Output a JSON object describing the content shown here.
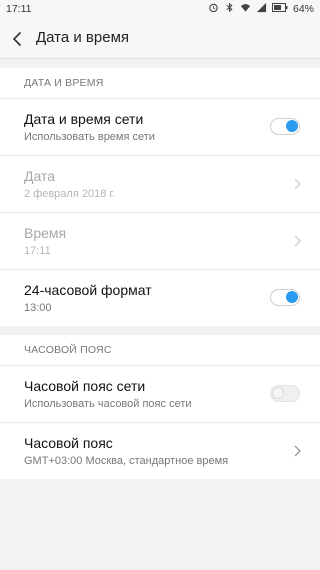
{
  "status": {
    "time": "17:11",
    "battery": "64%",
    "icons": [
      "alarm-icon",
      "bluetooth-icon",
      "wifi-icon",
      "signal-icon",
      "battery-icon"
    ]
  },
  "header": {
    "title": "Дата и время"
  },
  "sections": [
    {
      "header": "ДАТА И ВРЕМЯ",
      "items": [
        {
          "label": "Дата и время сети",
          "sub": "Использовать время сети",
          "control": "toggle",
          "state": "on"
        },
        {
          "label": "Дата",
          "sub": "2 февраля 2018 г.",
          "control": "chevron",
          "state": "disabled"
        },
        {
          "label": "Время",
          "sub": "17:11",
          "control": "chevron",
          "state": "disabled"
        },
        {
          "label": "24-часовой формат",
          "sub": "13:00",
          "control": "toggle",
          "state": "on"
        }
      ]
    },
    {
      "header": "ЧАСОВОЙ ПОЯС",
      "items": [
        {
          "label": "Часовой пояс сети",
          "sub": "Использовать часовой пояс сети",
          "control": "toggle",
          "state": "off"
        },
        {
          "label": "Часовой пояс",
          "sub": "GMT+03:00 Москва, стандартное время",
          "control": "chevron",
          "state": "enabled"
        }
      ]
    }
  ],
  "colors": {
    "accent": "#2a9bf0"
  }
}
